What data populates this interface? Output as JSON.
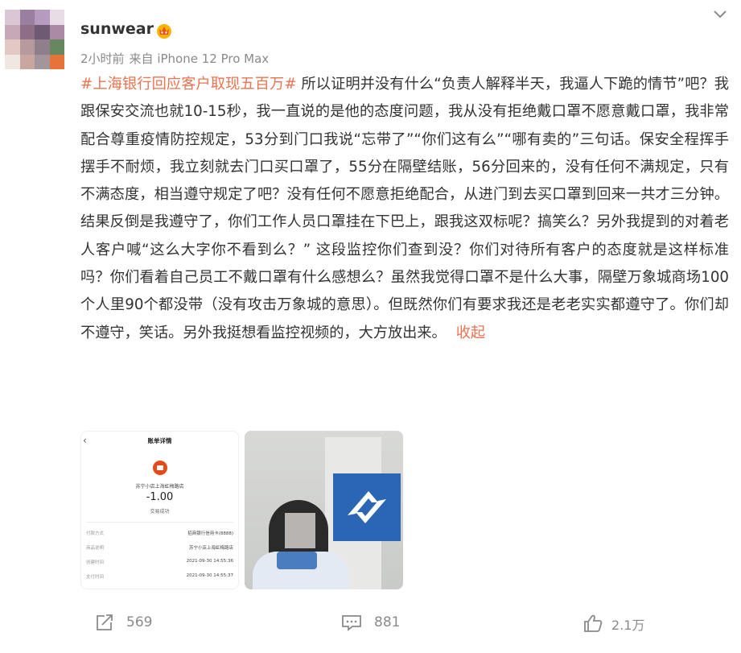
{
  "post": {
    "username": "sunwear",
    "time": "2小时前",
    "source": "来自 iPhone 12 Pro Max",
    "hashtag": "#上海银行回应客户取现五百万#",
    "body": " 所以证明并没有什么“负责人解释半天，我逼人下跪的情节”吧？我跟保安交流也就10-15秒，我一直说的是他的态度问题，我从没有拒绝戴口罩不愿意戴口罩，我非常配合尊重疫情防控规定，53分到门口我说“忘带了”“你们这有么”“哪有卖的”三句话。保安全程挥手摆手不耐烦，我立刻就去门口买口罩了，55分在隔壁结账，56分回来的，没有任何不满规定，只有不满态度，相当遵守规定了吧？没有任何不愿意拒绝配合，从进门到去买口罩到回来一共才三分钟。结果反倒是我遵守了，你们工作人员口罩挂在下巴上，跟我这双标呢？搞笑么？另外我提到的对着老人客户喊“这么大字你不看到么？” 这段监控你们查到没？你们对待所有客户的态度就是这样标准吗？你们看着自己员工不戴口罩有什么感想么？虽然我觉得口罩不是什么大事，隔壁万象城商场100个人里90个都没带（没有攻击万象城的意思）。但既然你们有要求我还是老老实实都遵守了。你们却不遵守，笑话。另外我挺想看监控视频的，大方放出来。",
    "collapse_label": "收起"
  },
  "receipt": {
    "title": "账单详情",
    "back": "‹",
    "store": "苏宁小店上海虹梅路店",
    "amount": "-1.00",
    "status": "交易成功",
    "rows": [
      {
        "label": "付款方式",
        "value": "招商银行信用卡(8888)"
      },
      {
        "label": "商品说明",
        "value": "苏宁小店上海虹梅路店"
      },
      {
        "label": "创建时间",
        "value": "2021-09-30 14:55:36"
      },
      {
        "label": "支付时间",
        "value": "2021-09-30 14:55:37"
      }
    ]
  },
  "actions": {
    "repost_count": "569",
    "comment_count": "881",
    "like_count": "2.1万"
  },
  "colors": {
    "accent": "#eb7350",
    "text": "#333333",
    "meta": "#8a8a8a"
  },
  "icons": {
    "vip": "vip-crown-icon",
    "menu": "chevron-down-icon",
    "repost": "repost-icon",
    "comment": "comment-icon",
    "like": "thumbs-up-icon"
  }
}
